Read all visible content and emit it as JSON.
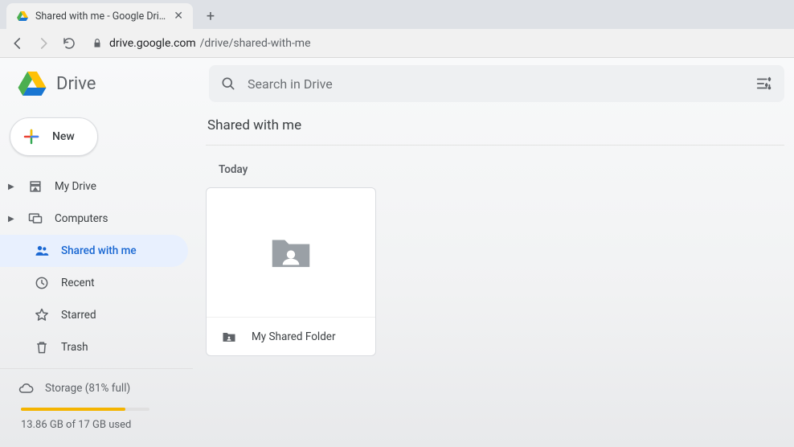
{
  "browser": {
    "tab_title": "Shared with me - Google Drive",
    "url_host": "drive.google.com",
    "url_path": "/drive/shared-with-me"
  },
  "brand": {
    "name": "Drive"
  },
  "search": {
    "placeholder": "Search in Drive"
  },
  "sidebar": {
    "new_label": "New",
    "items": [
      {
        "label": "My Drive",
        "icon": "drive",
        "expandable": true,
        "active": false
      },
      {
        "label": "Computers",
        "icon": "computers",
        "expandable": true,
        "active": false
      },
      {
        "label": "Shared with me",
        "icon": "shared",
        "expandable": false,
        "active": true
      },
      {
        "label": "Recent",
        "icon": "recent",
        "expandable": false,
        "active": false
      },
      {
        "label": "Starred",
        "icon": "starred",
        "expandable": false,
        "active": false
      },
      {
        "label": "Trash",
        "icon": "trash",
        "expandable": false,
        "active": false
      }
    ],
    "storage": {
      "label": "Storage (81% full)",
      "percent": 81,
      "used_text": "13.86 GB of 17 GB used",
      "fill_color": "#f4b400"
    }
  },
  "main": {
    "page_title": "Shared with me",
    "section_label": "Today",
    "items": [
      {
        "name": "My Shared Folder",
        "type": "shared-folder"
      }
    ]
  }
}
